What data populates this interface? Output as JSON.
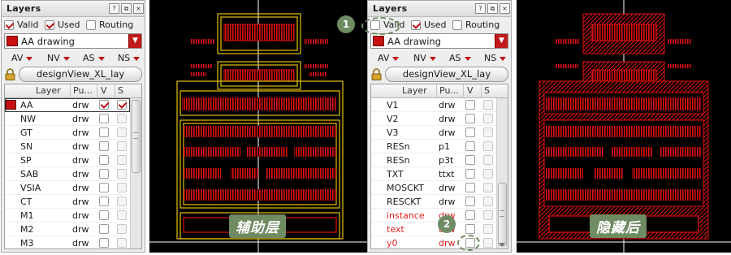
{
  "left_panel": {
    "title": "Layers",
    "filters": [
      {
        "label": "Valid",
        "checked": true
      },
      {
        "label": "Used",
        "checked": true
      },
      {
        "label": "Routing",
        "checked": false
      }
    ],
    "current_layer": "AA drawing",
    "filter_bar": [
      "AV",
      "NV",
      "AS",
      "NS"
    ],
    "view_name": "designView_XL_lay",
    "columns": [
      "Layer",
      "Pu...",
      "V",
      "S"
    ],
    "rows": [
      {
        "name": "AA",
        "purpose": "drw"
      },
      {
        "name": "NW",
        "purpose": "drw"
      },
      {
        "name": "GT",
        "purpose": "drw"
      },
      {
        "name": "SN",
        "purpose": "drw"
      },
      {
        "name": "SP",
        "purpose": "drw"
      },
      {
        "name": "SAB",
        "purpose": "drw"
      },
      {
        "name": "VSIA",
        "purpose": "drw"
      },
      {
        "name": "CT",
        "purpose": "drw"
      },
      {
        "name": "M1",
        "purpose": "drw"
      },
      {
        "name": "M2",
        "purpose": "drw"
      },
      {
        "name": "M3",
        "purpose": "drw"
      }
    ]
  },
  "right_panel": {
    "title": "Layers",
    "filters": [
      {
        "label": "Valid",
        "checked": false
      },
      {
        "label": "Used",
        "checked": true
      },
      {
        "label": "Routing",
        "checked": false
      }
    ],
    "current_layer": "AA drawing",
    "filter_bar": [
      "AV",
      "NV",
      "AS",
      "NS"
    ],
    "view_name": "designView_XL_lay",
    "columns": [
      "Layer",
      "Pu...",
      "V",
      "S"
    ],
    "rows": [
      {
        "name": "V1",
        "purpose": "drw"
      },
      {
        "name": "V2",
        "purpose": "drw"
      },
      {
        "name": "V3",
        "purpose": "drw"
      },
      {
        "name": "RESn",
        "purpose": "p1"
      },
      {
        "name": "RESn",
        "purpose": "p3t"
      },
      {
        "name": "TXT",
        "purpose": "ttxt"
      },
      {
        "name": "MOSCKT",
        "purpose": "drw"
      },
      {
        "name": "RESCKT",
        "purpose": "drw"
      },
      {
        "name": "instance",
        "purpose": "drw"
      },
      {
        "name": "text",
        "purpose": "drw"
      },
      {
        "name": "y0",
        "purpose": "drw"
      }
    ]
  },
  "canvas_left": {
    "caption": "辅助层"
  },
  "canvas_right": {
    "caption": "隐藏后"
  },
  "callouts": [
    "1",
    "2"
  ],
  "colors": {
    "layer_red": "#c81010",
    "aux_yellow": "#e6c200",
    "canvas_bg": "#000000",
    "callout_green": "#6f8b62"
  }
}
